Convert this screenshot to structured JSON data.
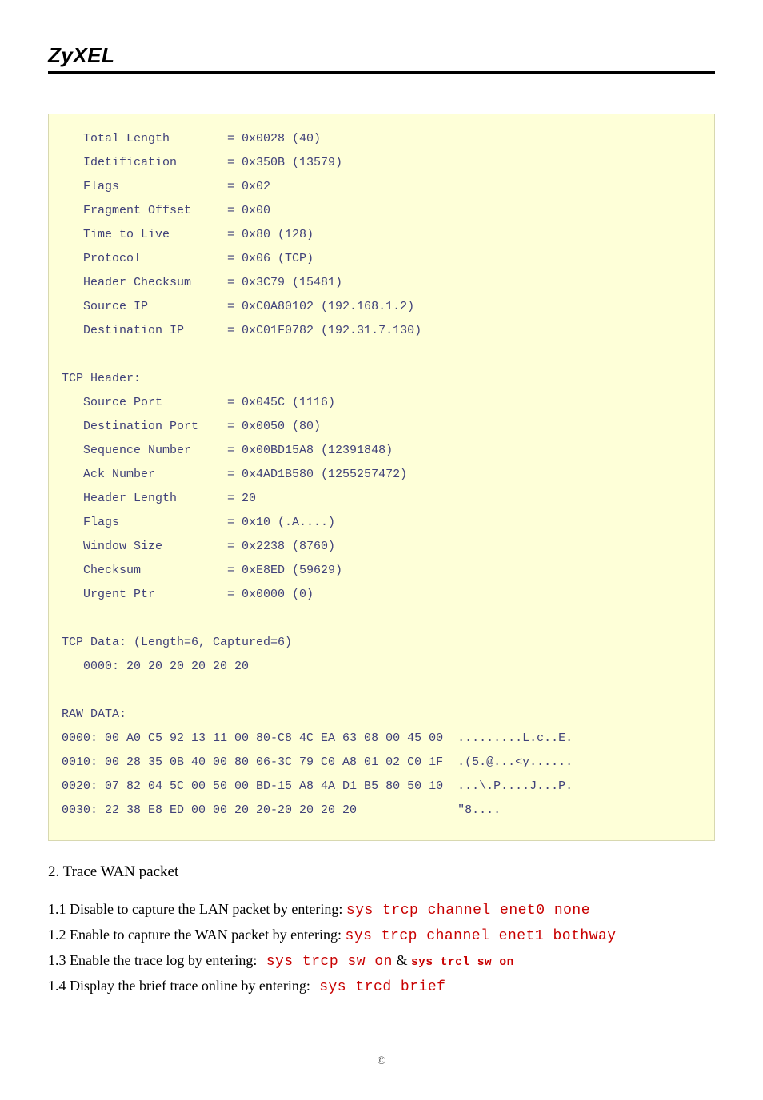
{
  "brand": "ZyXEL",
  "codebox": "   Total Length        = 0x0028 (40)\n   Idetification       = 0x350B (13579)\n   Flags               = 0x02\n   Fragment Offset     = 0x00\n   Time to Live        = 0x80 (128)\n   Protocol            = 0x06 (TCP)\n   Header Checksum     = 0x3C79 (15481)\n   Source IP           = 0xC0A80102 (192.168.1.2)\n   Destination IP      = 0xC01F0782 (192.31.7.130)\n\nTCP Header:\n   Source Port         = 0x045C (1116)\n   Destination Port    = 0x0050 (80)\n   Sequence Number     = 0x00BD15A8 (12391848)\n   Ack Number          = 0x4AD1B580 (1255257472)\n   Header Length       = 20\n   Flags               = 0x10 (.A....)\n   Window Size         = 0x2238 (8760)\n   Checksum            = 0xE8ED (59629)\n   Urgent Ptr          = 0x0000 (0)\n\nTCP Data: (Length=6, Captured=6)\n   0000: 20 20 20 20 20 20\n\nRAW DATA:\n0000: 00 A0 C5 92 13 11 00 80-C8 4C EA 63 08 00 45 00  .........L.c..E.\n0010: 00 28 35 0B 40 00 80 06-3C 79 C0 A8 01 02 C0 1F  .(5.@...<y......\n0020: 07 82 04 5C 00 50 00 BD-15 A8 4A D1 B5 80 50 10  ...\\.P....J...P.\n0030: 22 38 E8 ED 00 00 20 20-20 20 20 20              \"8....",
  "section_title": "2. Trace WAN packet",
  "steps": {
    "s1_pre": "1.1 Disable to capture the LAN packet by entering: ",
    "s1_cmd": "sys trcp channel enet0 none",
    "s2_pre": "1.2 Enable to capture the WAN packet by entering: ",
    "s2_cmd": "sys trcp channel enet1 bothway",
    "s3_pre": "1.3 Enable the trace log by entering:",
    "s3_cmd1": " sys trcp sw on",
    "s3_amp": " & ",
    "s3_cmd2": "sys trcl sw on",
    "s4_pre": "1.4 Display the brief trace online by entering:",
    "s4_cmd": " sys trcd brief"
  },
  "footer": "©"
}
